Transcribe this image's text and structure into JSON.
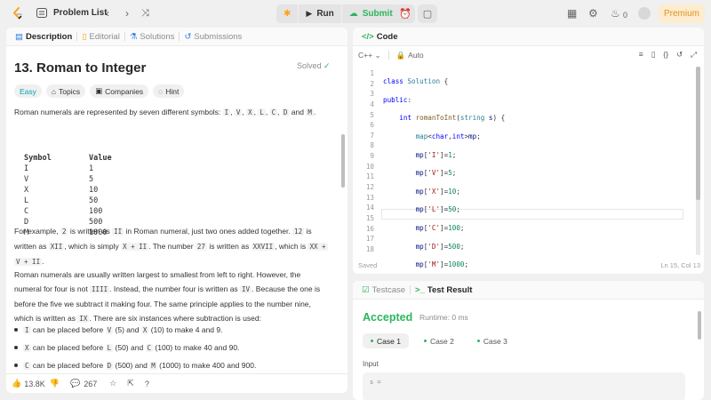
{
  "topbar": {
    "problem_list_label": "Problem List",
    "run_label": "Run",
    "submit_label": "Submit",
    "likes_count": "0",
    "premium_label": "Premium"
  },
  "description_panel": {
    "tabs": [
      {
        "label": "Description",
        "icon": "doc-icon"
      },
      {
        "label": "Editorial",
        "icon": "book-icon"
      },
      {
        "label": "Solutions",
        "icon": "flask-icon"
      },
      {
        "label": "Submissions",
        "icon": "history-icon"
      }
    ],
    "title": "13. Roman to Integer",
    "solved_label": "Solved",
    "tags": [
      "Easy",
      "Topics",
      "Companies",
      "Hint"
    ],
    "intro": {
      "prefix": "Roman numerals are represented by seven different symbols: ",
      "symbols": [
        "I",
        "V",
        "X",
        "L",
        "C",
        "D",
        "M"
      ],
      "sep": ", ",
      "and": " and ",
      "end": "."
    },
    "symbol_table": {
      "headers": [
        "Symbol",
        "Value"
      ],
      "rows": [
        [
          "I",
          "1"
        ],
        [
          "V",
          "5"
        ],
        [
          "X",
          "10"
        ],
        [
          "L",
          "50"
        ],
        [
          "C",
          "100"
        ],
        [
          "D",
          "500"
        ],
        [
          "M",
          "1000"
        ]
      ]
    },
    "example_paragraph": {
      "p1": "For example, ",
      "c1": "2",
      "p2": " is written as ",
      "c2": "II",
      "p3": " in Roman numeral, just two ones added together. ",
      "c3": "12",
      "p4": " is",
      "p5": "written as ",
      "c4": "XII",
      "p6": ", which is simply ",
      "c5": "X + II",
      "p7": ". The number ",
      "c6": "27",
      "p8": " is written as ",
      "c7": "XXVII",
      "p9": ", which is ",
      "c8": "XX +",
      "c9": "V + II",
      "p10": "."
    },
    "order_paragraph": {
      "line1": "Roman numerals are usually written largest to smallest from left to right. However, the",
      "line2_a": "numeral for four is not ",
      "line2_c": "IIII",
      "line2_b": ". Instead, the number four is written as ",
      "line2_c2": "IV",
      "line2_d": ". Because the one is",
      "line3": "before the five we subtract it making four. The same principle applies to the number nine,",
      "line4_a": "which is written as ",
      "line4_c": "IX",
      "line4_b": ". There are six instances where subtraction is used:"
    },
    "bullets": [
      {
        "c1": "I",
        "t1": " can be placed before ",
        "c2": "V",
        "t2": " (5) and ",
        "c3": "X",
        "t3": " (10) to make 4 and 9."
      },
      {
        "c1": "X",
        "t1": " can be placed before ",
        "c2": "L",
        "t2": " (50) and ",
        "c3": "C",
        "t3": " (100) to make 40 and 90."
      },
      {
        "c1": "C",
        "t1": " can be placed before ",
        "c2": "D",
        "t2": " (500) and ",
        "c3": "M",
        "t3": " (1000) to make 400 and 900."
      }
    ],
    "footer": {
      "likes": "13.8K",
      "comments": "267"
    }
  },
  "code_panel": {
    "tab_label": "Code",
    "language": "C++",
    "mode": "Auto",
    "line_numbers": [
      "1",
      "2",
      "3",
      "4",
      "5",
      "6",
      "7",
      "8",
      "9",
      "10",
      "11",
      "12",
      "13",
      "14",
      "15",
      "16",
      "17",
      "18"
    ],
    "saved_label": "Saved",
    "cursor_position": "Ln 15, Col 13"
  },
  "test_panel": {
    "tabs": [
      "Testcase",
      "Test Result"
    ],
    "status": "Accepted",
    "runtime": "Runtime: 0 ms",
    "cases": [
      "Case 1",
      "Case 2",
      "Case 3"
    ],
    "input_label": "Input",
    "input_value": "s ="
  }
}
